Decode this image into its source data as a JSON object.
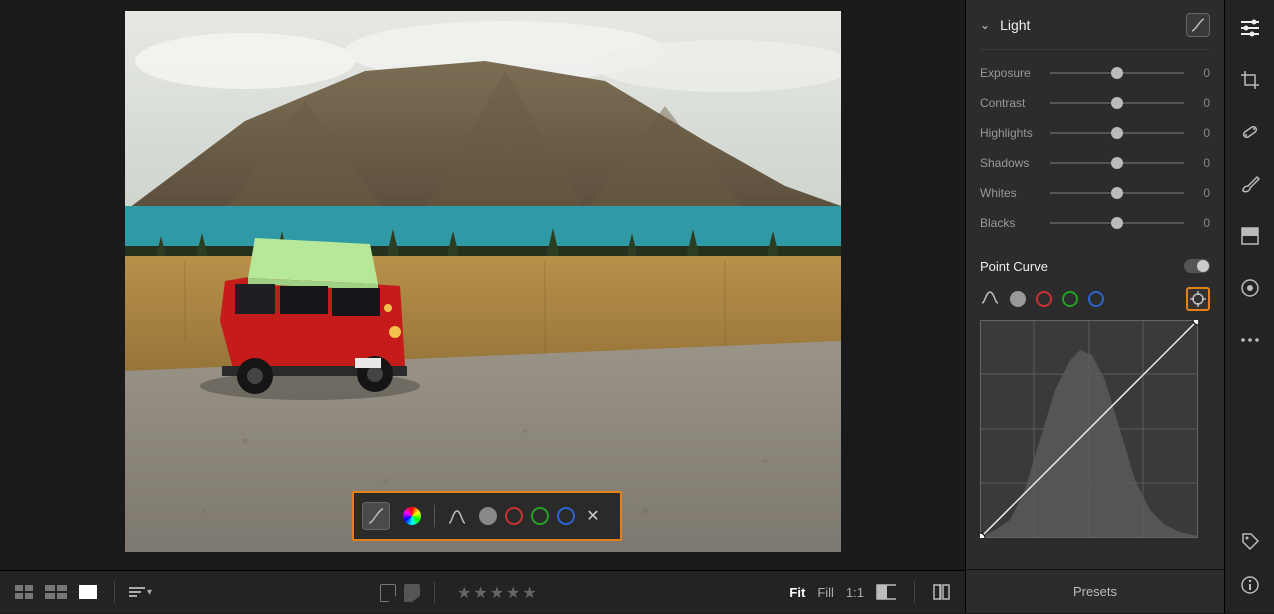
{
  "panel": {
    "title": "Light",
    "sliders": [
      {
        "label": "Exposure",
        "value": 0
      },
      {
        "label": "Contrast",
        "value": 0
      },
      {
        "label": "Highlights",
        "value": 0
      },
      {
        "label": "Shadows",
        "value": 0
      },
      {
        "label": "Whites",
        "value": 0
      },
      {
        "label": "Blacks",
        "value": 0
      }
    ],
    "point_curve": {
      "title": "Point Curve",
      "enabled": true,
      "channels": [
        "parametric",
        "luma",
        "red",
        "green",
        "blue"
      ],
      "target_active": true
    },
    "presets_label": "Presets"
  },
  "bottom": {
    "zoom": {
      "fit": "Fit",
      "fill": "Fill",
      "one_to_one": "1:1",
      "active": "Fit"
    }
  },
  "floating_toolbar": {
    "channels": [
      "curve",
      "colorwheel",
      "parametric",
      "luma",
      "red",
      "green",
      "blue",
      "close"
    ]
  },
  "tool_strip": {
    "tools": [
      "edit-sliders",
      "crop",
      "healing",
      "brush",
      "linear-gradient",
      "radial-gradient",
      "more"
    ],
    "bottom": [
      "tag",
      "info"
    ]
  }
}
